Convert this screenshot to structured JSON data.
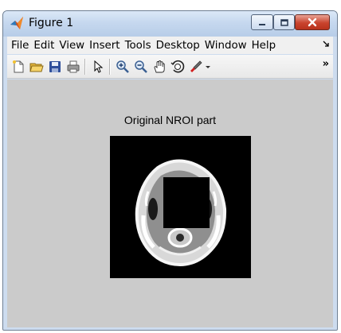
{
  "window": {
    "title": "Figure 1",
    "icons": {
      "app": "matlab-icon",
      "minimize": "minimize-icon",
      "maximize": "maximize-icon",
      "close": "close-icon"
    }
  },
  "menubar": {
    "items": [
      "File",
      "Edit",
      "View",
      "Insert",
      "Tools",
      "Desktop",
      "Window",
      "Help"
    ],
    "overflow_icon": "menu-overflow-icon"
  },
  "toolbar": {
    "buttons": [
      "new-figure-icon",
      "open-file-icon",
      "save-icon",
      "print-icon",
      "edit-plot-icon",
      "zoom-in-icon",
      "zoom-out-icon",
      "pan-icon",
      "rotate-3d-icon",
      "data-cursor-brush-icon"
    ],
    "overflow_label": "»"
  },
  "figure": {
    "axes_title": "Original NROI part",
    "background": "#cbcbcb",
    "image_background": "#000000"
  }
}
